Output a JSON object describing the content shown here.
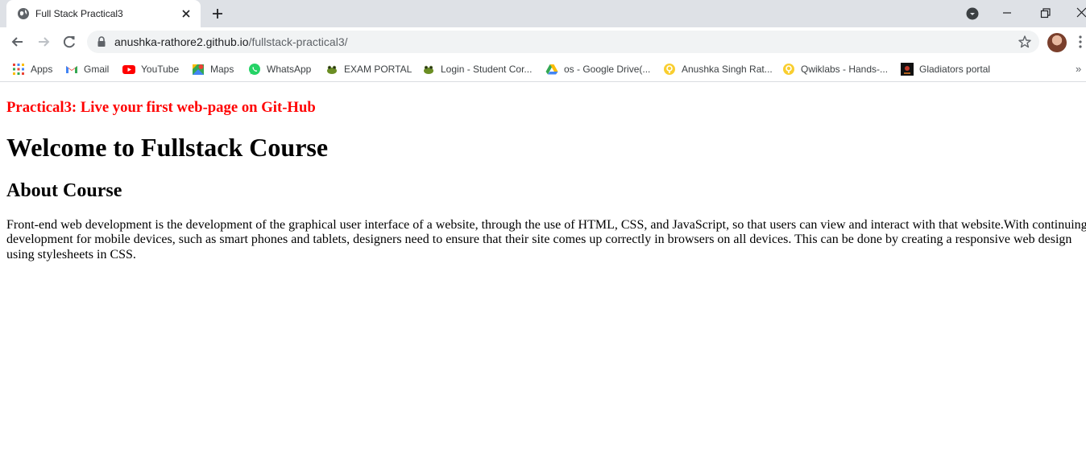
{
  "browser": {
    "tab": {
      "title": "Full Stack Practical3"
    },
    "url": {
      "host": "anushka-rathore2.github.io",
      "path": "/fullstack-practical3/"
    }
  },
  "bookmarks": [
    {
      "label": "Apps",
      "icon": "apps-grid-icon"
    },
    {
      "label": "Gmail",
      "icon": "gmail-icon"
    },
    {
      "label": "YouTube",
      "icon": "youtube-icon"
    },
    {
      "label": "Maps",
      "icon": "maps-icon"
    },
    {
      "label": "WhatsApp",
      "icon": "whatsapp-icon"
    },
    {
      "label": "EXAM  PORTAL",
      "icon": "frog-icon"
    },
    {
      "label": "Login - Student Cor...",
      "icon": "frog-icon"
    },
    {
      "label": "os - Google Drive(...",
      "icon": "google-drive-icon"
    },
    {
      "label": "Anushka Singh Rat...",
      "icon": "qwiklabs-icon"
    },
    {
      "label": "Qwiklabs - Hands-...",
      "icon": "qwiklabs-icon"
    },
    {
      "label": "Gladiators portal",
      "icon": "gladiators-icon"
    }
  ],
  "bookmarks_more": "»",
  "page": {
    "practical_heading": "Practical3: Live your first web-page on Git-Hub",
    "main_heading": "Welcome to Fullstack Course",
    "about_heading": "About Course",
    "paragraph": "Front-end web development is the development of the graphical user interface of a website, through the use of HTML, CSS, and JavaScript, so that users can view and interact with that website.With continuing development for mobile devices, such as smart phones and tablets, designers need to ensure that their site comes up correctly in browsers on all devices. This can be done by creating a responsive web design using stylesheets in CSS."
  },
  "colors": {
    "practical_heading": "#ff0000",
    "tabstrip_bg": "#dee1e6",
    "omnibox_bg": "#f1f3f4"
  }
}
